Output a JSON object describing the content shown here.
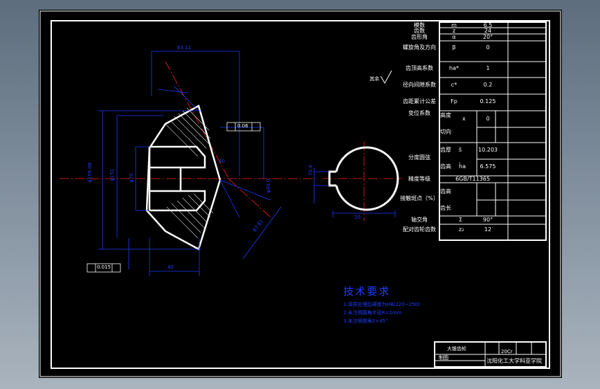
{
  "params": {
    "rows": [
      {
        "name": "模数",
        "sym": "m",
        "val": "6.5"
      },
      {
        "name": "齿数",
        "sym": "z",
        "val": "24"
      },
      {
        "name": "齿形角",
        "sym": "α",
        "val": "20°"
      },
      {
        "name": "螺旋角及方向",
        "sym": "β",
        "val": "0"
      },
      {
        "name": "齿顶高系数",
        "sym": "ha*",
        "val": "1"
      },
      {
        "name": "径向间隙系数",
        "sym": "c*",
        "val": "0.2"
      },
      {
        "name": "齿距累计公差",
        "sym": "Fp",
        "val": "0.125"
      }
    ],
    "shift": {
      "name": "变位系数",
      "sub1": "高度",
      "sub2": "切向",
      "sym": "x",
      "val": "0"
    },
    "tooth": {
      "name": "分度圆弦",
      "sub1": "齿厚",
      "sym1": "s̄",
      "val1": "10.203",
      "sub2": "齿高",
      "sym2": "h̄a",
      "val2": "6.575"
    },
    "accuracy": {
      "name": "精度等级",
      "val": "6GB/T11365"
    },
    "contact": {
      "name": "接触斑点（%）",
      "sub1": "齿高",
      "sub2": "齿长"
    },
    "shaft_angle": {
      "name": "轴交角",
      "sym": "Σ",
      "val": "90°"
    },
    "mating": {
      "name": "配对齿轮齿数",
      "sym": "z₂",
      "val": "12"
    }
  },
  "drawing": {
    "dim_top": "63.12",
    "dim_left_outer": "φ159.08",
    "dim_left_inner": "φ151",
    "dim_left_bore": "φ70",
    "dim_right": "φ40.0",
    "dim_slant": "87.81",
    "dim_face": "40",
    "dim_bottom": "40",
    "tol_box_1": "0.06",
    "tol_box_2": "0.015",
    "roughness_label": "其余",
    "keyway_width": "20",
    "keyway_depth": "70.4"
  },
  "notes": {
    "heading": "技术要求",
    "lines": [
      "1.调质处理后硬度为HB(220~250)",
      "2.未注明圆角半径R=2mm",
      "3.未注明倒角2×45°"
    ]
  },
  "titleblock": {
    "part_name": "大锥齿轮",
    "material": "20Cr",
    "designer": "制图",
    "school": "沈阳化工大学科亚学院"
  }
}
